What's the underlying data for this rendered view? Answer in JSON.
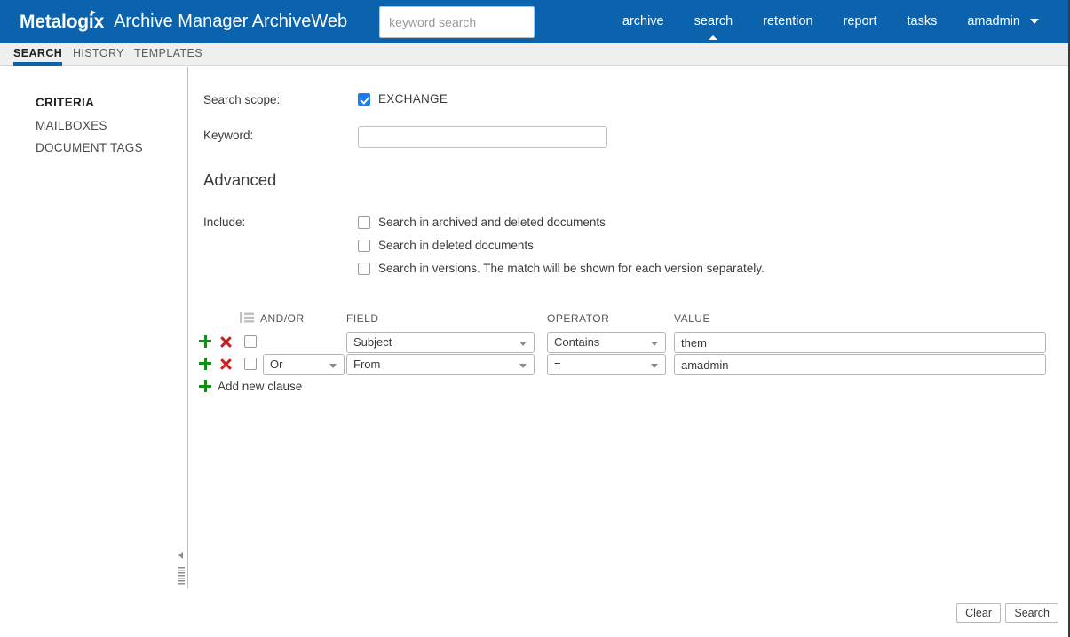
{
  "header": {
    "brand": "Metalogix",
    "app_name": "Archive Manager ArchiveWeb",
    "keyword_search_placeholder": "keyword search",
    "keyword_search_value": "",
    "nav": [
      {
        "label": "archive",
        "active": false
      },
      {
        "label": "search",
        "active": true
      },
      {
        "label": "retention",
        "active": false
      },
      {
        "label": "report",
        "active": false
      },
      {
        "label": "tasks",
        "active": false
      },
      {
        "label": "amadmin",
        "active": false
      }
    ],
    "accent_color": "#0a63ac"
  },
  "tabs": [
    {
      "label": "SEARCH",
      "active": true
    },
    {
      "label": "HISTORY",
      "active": false
    },
    {
      "label": "TEMPLATES",
      "active": false
    }
  ],
  "sidebar": {
    "items": [
      {
        "label": "CRITERIA",
        "active": true
      },
      {
        "label": "MAILBOXES",
        "active": false
      },
      {
        "label": "DOCUMENT TAGS",
        "active": false
      }
    ]
  },
  "main": {
    "scope_label": "Search scope:",
    "scope_option": {
      "label": "EXCHANGE",
      "checked": true
    },
    "keyword_label": "Keyword:",
    "keyword_value": "",
    "advanced_title": "Advanced",
    "include_label": "Include:",
    "include_options": [
      {
        "label": "Search in archived and deleted documents",
        "checked": false
      },
      {
        "label": "Search in deleted documents",
        "checked": false
      },
      {
        "label": "Search in versions. The match will be shown for each version separately.",
        "checked": false
      }
    ],
    "clause_table": {
      "columns": {
        "andor": "AND/OR",
        "field": "FIELD",
        "operator": "OPERATOR",
        "value": "VALUE"
      },
      "rows": [
        {
          "selected": false,
          "andor": "",
          "field": "Subject",
          "operator": "Contains",
          "value": "them"
        },
        {
          "selected": false,
          "andor": "Or",
          "field": "From",
          "operator": "=",
          "value": "amadmin"
        }
      ],
      "add_new_label": "Add new clause"
    }
  },
  "footer": {
    "clear_label": "Clear",
    "search_label": "Search"
  }
}
